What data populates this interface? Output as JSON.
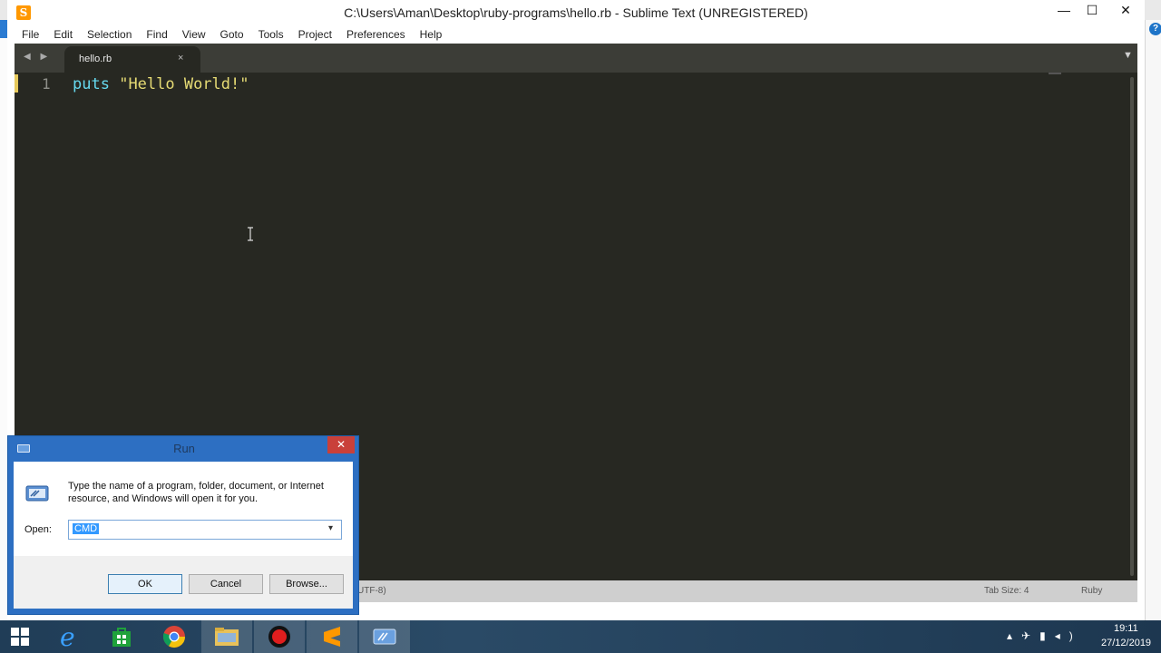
{
  "window": {
    "title": "C:\\Users\\Aman\\Desktop\\ruby-programs\\hello.rb - Sublime Text (UNREGISTERED)",
    "minimize": "—",
    "maximize": "☐",
    "close": "✕"
  },
  "menu": [
    "File",
    "Edit",
    "Selection",
    "Find",
    "View",
    "Goto",
    "Tools",
    "Project",
    "Preferences",
    "Help"
  ],
  "tabs": {
    "nav": "◀ ▶",
    "active_label": "hello.rb",
    "close": "×",
    "dropdown": "▼"
  },
  "editor": {
    "line_number": "1",
    "code_keyword": "puts",
    "code_string": "\"Hello World!\""
  },
  "status": {
    "encoding": "UTF-8)",
    "tab_size": "Tab Size: 4",
    "syntax": "Ruby"
  },
  "run_dialog": {
    "title": "Run",
    "close": "✕",
    "description": "Type the name of a program, folder, document, or Internet resource, and Windows will open it for you.",
    "open_label": "Open:",
    "input_value": "CMD",
    "ok": "OK",
    "cancel": "Cancel",
    "browse": "Browse..."
  },
  "taskbar": {
    "time": "19:11",
    "date": "27/12/2019"
  },
  "colors": {
    "editor_bg": "#272822",
    "keyword": "#66d9ef",
    "string": "#e6db74",
    "dialog_border": "#2d6fc2",
    "taskbar": "#1f3b55"
  }
}
